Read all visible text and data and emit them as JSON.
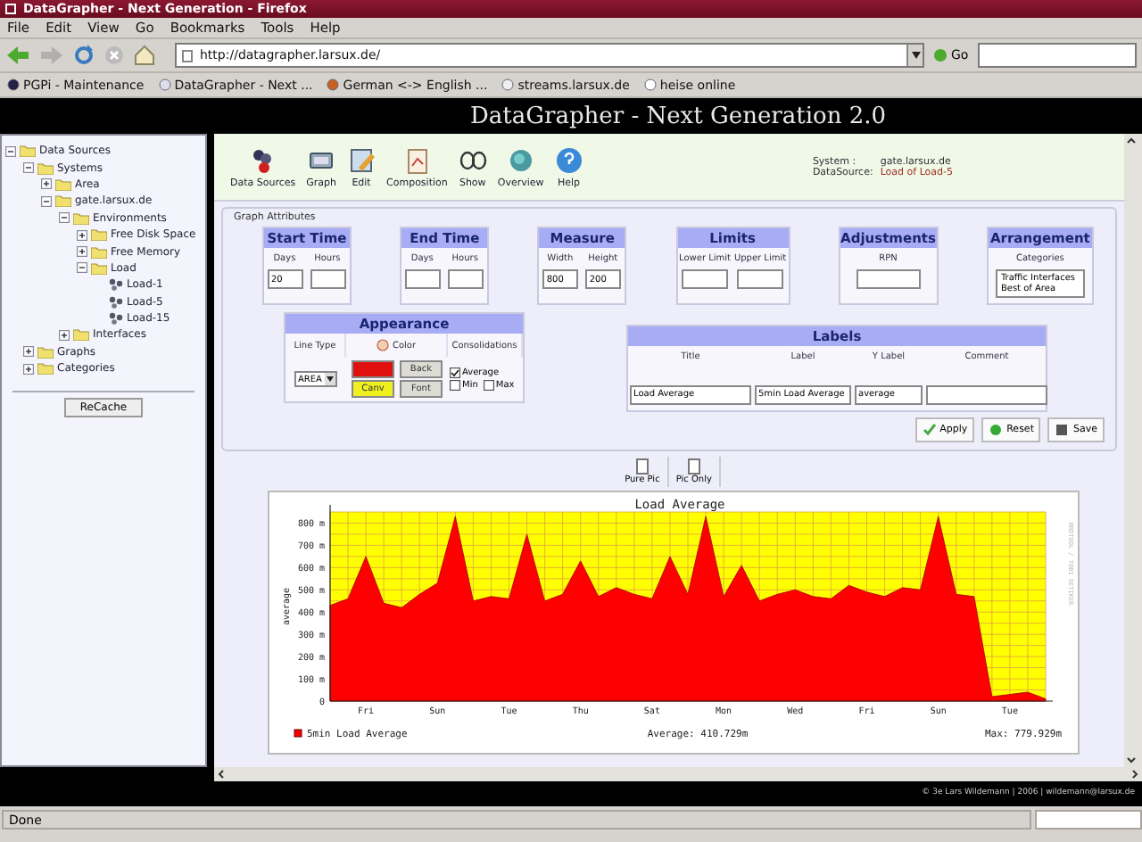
{
  "browser": {
    "title": "DataGrapher - Next Generation - Firefox",
    "menu": [
      "File",
      "Edit",
      "View",
      "Go",
      "Bookmarks",
      "Tools",
      "Help"
    ],
    "url": "http://datagrapher.larsux.de/",
    "go": "Go",
    "bookmarks": [
      {
        "label": "PGPi - Maintenance"
      },
      {
        "label": "DataGrapher - Next ..."
      },
      {
        "label": "German <-> English ..."
      },
      {
        "label": "streams.larsux.de"
      },
      {
        "label": "heise online"
      }
    ],
    "status": "Done"
  },
  "header": {
    "title": "DataGrapher - Next Generation 2.0"
  },
  "sidebar": {
    "tree": [
      {
        "label": "Data Sources",
        "kind": "folder",
        "expanded": true,
        "children": [
          {
            "label": "Systems",
            "kind": "folder",
            "expanded": true,
            "children": [
              {
                "label": "Area",
                "kind": "folder",
                "expanded": false
              },
              {
                "label": "gate.larsux.de",
                "kind": "folder",
                "expanded": true,
                "children": [
                  {
                    "label": "Environments",
                    "kind": "folder",
                    "expanded": true,
                    "children": [
                      {
                        "label": "Free Disk Space",
                        "kind": "folder",
                        "expanded": false
                      },
                      {
                        "label": "Free Memory",
                        "kind": "folder",
                        "expanded": false
                      },
                      {
                        "label": "Load",
                        "kind": "folder",
                        "expanded": true,
                        "children": [
                          {
                            "label": "Load-1",
                            "kind": "leaf"
                          },
                          {
                            "label": "Load-5",
                            "kind": "leaf"
                          },
                          {
                            "label": "Load-15",
                            "kind": "leaf"
                          }
                        ]
                      }
                    ]
                  },
                  {
                    "label": "Interfaces",
                    "kind": "folder",
                    "expanded": false
                  }
                ]
              }
            ]
          },
          {
            "label": "Graphs",
            "kind": "folder",
            "expanded": false
          },
          {
            "label": "Categories",
            "kind": "folder",
            "expanded": false
          }
        ]
      }
    ],
    "button": "ReCache"
  },
  "toolbar": {
    "items": [
      {
        "label": "Data Sources"
      },
      {
        "label": "Graph"
      },
      {
        "label": "Edit"
      },
      {
        "label": "Composition"
      },
      {
        "label": "Show"
      },
      {
        "label": "Overview"
      },
      {
        "label": "Help"
      }
    ],
    "info": [
      {
        "label": "System :",
        "value": "gate.larsux.de"
      },
      {
        "label": "DataSource:",
        "value": "Load of Load-5"
      }
    ]
  },
  "graph_attributes": {
    "legend": "Graph Attributes",
    "groups": [
      {
        "title": "Start Time",
        "kind": "inputs",
        "fields": [
          {
            "label": "Days",
            "value": "20"
          },
          {
            "label": "Hours"
          }
        ]
      },
      {
        "title": "End Time",
        "kind": "inputs",
        "fields": [
          {
            "label": "Days"
          },
          {
            "label": "Hours"
          }
        ]
      },
      {
        "title": "Measure",
        "kind": "inputs",
        "fields": [
          {
            "label": "Width",
            "value": "800"
          },
          {
            "label": "Height",
            "value": "200"
          }
        ]
      },
      {
        "title": "Limits",
        "kind": "inputs",
        "fields": [
          {
            "label": "Lower Limit"
          },
          {
            "label": "Upper Limit"
          }
        ]
      },
      {
        "title": "Adjustments",
        "kind": "inputs",
        "fields": [
          {
            "label": "RPN"
          }
        ]
      },
      {
        "title": "Arrangement",
        "kind": "list",
        "subtitle": "Categories",
        "options": [
          "Traffic Interfaces",
          "Best of Area"
        ]
      }
    ],
    "appearance": {
      "title": "Appearance",
      "line_type_label": "Line Type",
      "color_label": "Color",
      "consolidations_label": "Consolidations",
      "line_type": "AREA",
      "color_buttons": [
        {
          "color": "#e01010"
        },
        {
          "label": "Back",
          "color": "#dcdcd4"
        },
        {
          "label": "Canv",
          "color": "#f0f020"
        },
        {
          "label": "Font",
          "color": "#dcdcd4"
        }
      ],
      "consolidations": [
        {
          "label": "Average",
          "checked": true
        },
        {
          "label": "Min",
          "checked": false
        },
        {
          "label": "Max",
          "checked": false
        }
      ]
    },
    "labels": {
      "title": "Labels",
      "fields": [
        {
          "label": "Title",
          "value": "Load Average"
        },
        {
          "label": "Label",
          "value": "5min Load Average"
        },
        {
          "label": "Y Label",
          "value": "average"
        },
        {
          "label": "Comment"
        }
      ]
    },
    "actions": [
      {
        "label": "Apply"
      },
      {
        "label": "Reset"
      },
      {
        "label": "Save"
      }
    ]
  },
  "pic_buttons": [
    {
      "label": "Pure Pic"
    },
    {
      "label": "Pic Only"
    }
  ],
  "chart": {
    "average_text": "Average: 410.729m",
    "max_text": "Max: 779.929m",
    "credit": "RRDTOOL / TOBI OETIKER",
    "chart_data": {
      "type": "area",
      "title": "Load Average",
      "ylabel": "average",
      "categories": [
        null,
        null,
        "Fri",
        null,
        null,
        null,
        "Sun",
        null,
        null,
        null,
        "Tue",
        null,
        null,
        null,
        "Thu",
        null,
        null,
        null,
        "Sat",
        null,
        null,
        null,
        "Mon",
        null,
        null,
        null,
        "Wed",
        null,
        null,
        null,
        "Fri",
        null,
        null,
        null,
        "Sun",
        null,
        null,
        null,
        "Tue",
        null,
        null
      ],
      "series": [
        {
          "name": "5min Load Average",
          "color": "#ff0000",
          "values": [
            430,
            460,
            650,
            440,
            420,
            480,
            530,
            830,
            450,
            470,
            460,
            750,
            450,
            480,
            630,
            470,
            510,
            480,
            460,
            650,
            480,
            830,
            470,
            610,
            450,
            480,
            500,
            470,
            460,
            520,
            490,
            470,
            510,
            500,
            830,
            480,
            470,
            20,
            30,
            40,
            10
          ]
        }
      ],
      "ylim": [
        0,
        850
      ],
      "grid": true,
      "yticks": [
        {
          "value": 0,
          "label": "0"
        },
        {
          "value": 100,
          "label": "100 m"
        },
        {
          "value": 200,
          "label": "200 m"
        },
        {
          "value": 300,
          "label": "300 m"
        },
        {
          "value": 400,
          "label": "400 m"
        },
        {
          "value": 500,
          "label": "500 m"
        },
        {
          "value": 600,
          "label": "600 m"
        },
        {
          "value": 700,
          "label": "700 m"
        },
        {
          "value": 800,
          "label": "800 m"
        }
      ]
    }
  },
  "footer": {
    "copyright": "© 3e Lars Wildemann | 2006 | wildemann@larsux.de"
  }
}
